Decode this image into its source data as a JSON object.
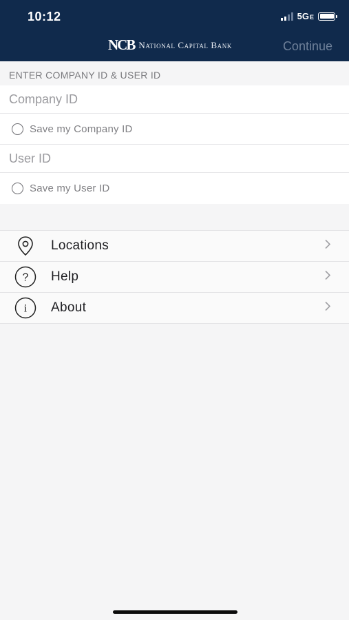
{
  "status_bar": {
    "time": "10:12",
    "network": "5G",
    "network_suffix": "E"
  },
  "header": {
    "logo_text": "NCB",
    "brand_name": "National Capital Bank",
    "continue_label": "Continue",
    "background_color": "#102a4c"
  },
  "login": {
    "section_title": "ENTER COMPANY ID & USER ID",
    "company_id_placeholder": "Company ID",
    "save_company_label": "Save my Company ID",
    "user_id_placeholder": "User ID",
    "save_user_label": "Save my User ID"
  },
  "menu": {
    "items": [
      {
        "label": "Locations",
        "icon": "location-pin-icon"
      },
      {
        "label": "Help",
        "icon": "question-circle-icon"
      },
      {
        "label": "About",
        "icon": "info-circle-icon"
      }
    ]
  }
}
